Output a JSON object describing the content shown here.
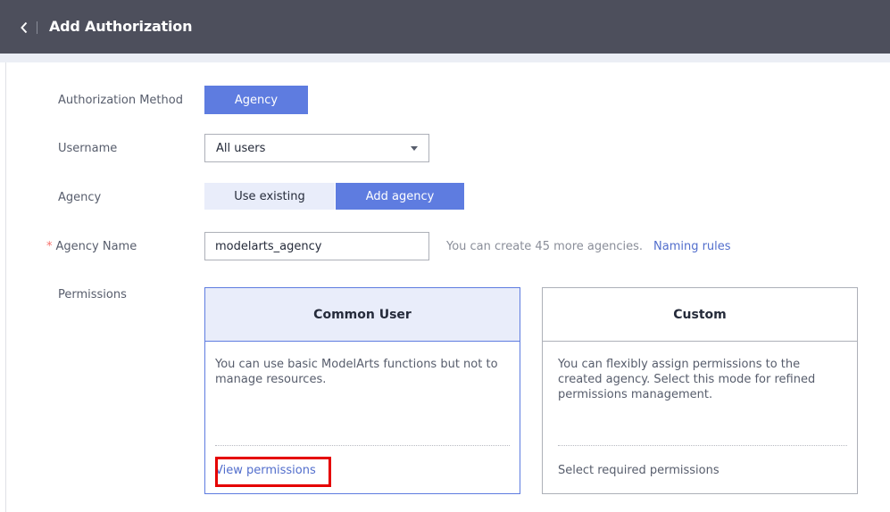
{
  "header": {
    "title": "Add Authorization",
    "back_icon": "chevron-left-icon"
  },
  "form": {
    "authorization_method": {
      "label": "Authorization Method",
      "button_label": "Agency"
    },
    "username": {
      "label": "Username",
      "selected": "All users"
    },
    "agency": {
      "label": "Agency",
      "options": [
        "Use existing",
        "Add agency"
      ],
      "selected": "Add agency"
    },
    "agency_name": {
      "required_mark": "*",
      "label": "Agency Name",
      "value": "modelarts_agency",
      "hint": "You can create 45 more agencies.",
      "naming_link": "Naming rules"
    },
    "permissions": {
      "label": "Permissions",
      "selected": "Common User",
      "cards": [
        {
          "title": "Common User",
          "description": "You can use basic ModelArts functions but not to manage resources.",
          "footer": "View permissions"
        },
        {
          "title": "Custom",
          "description": "You can flexibly assign permissions to the created agency. Select this mode for refined permissions management.",
          "footer": "Select required permissions"
        }
      ]
    }
  },
  "colors": {
    "topbar": "#4d4f5c",
    "primary": "#5e7ce0",
    "light_selected": "#e9edfa",
    "link": "#526ecc",
    "required": "#f66f6a",
    "highlight": "#e50000"
  }
}
